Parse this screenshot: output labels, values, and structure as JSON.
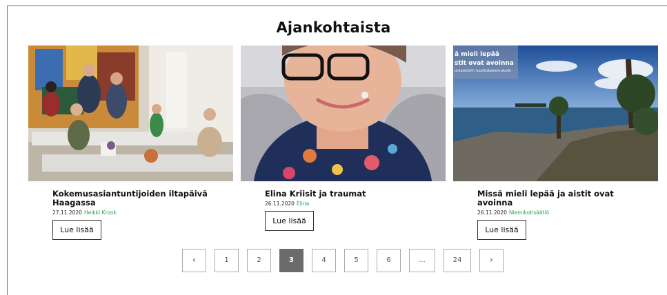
{
  "section": {
    "title": "Ajankohtaista"
  },
  "cards": [
    {
      "title": "Kokemusasiantuntijoiden iltapäivä Haagassa",
      "date": "27.11.2020",
      "author": "Heikki Krook",
      "button": "Lue lisää",
      "photo": "group-meeting-photo"
    },
    {
      "title": "Elina Kriisit ja traumat",
      "date": "26.11.2020",
      "author": "Elina",
      "button": "Lue lisää",
      "photo": "portrait-photo"
    },
    {
      "title": "Missä mieli lepää ja aistit ovat avoinna",
      "date": "26.11.2020",
      "author": "Niemikotisäätiö",
      "button": "Lue lisää",
      "photo": "seaside-landscape-photo",
      "overlay_line1": "ä mieli lepää",
      "overlay_line2": "stit ovat avoinna",
      "overlay_line3": "oniaistisiin luontokokemuksiin"
    }
  ],
  "pagination": {
    "prev": "‹",
    "pages": [
      "1",
      "2",
      "3",
      "4",
      "5",
      "6",
      "...",
      "24"
    ],
    "current": "3",
    "next": "›"
  },
  "colors": {
    "accent": "#2e9b52",
    "active_page": "#6b6b6b"
  }
}
